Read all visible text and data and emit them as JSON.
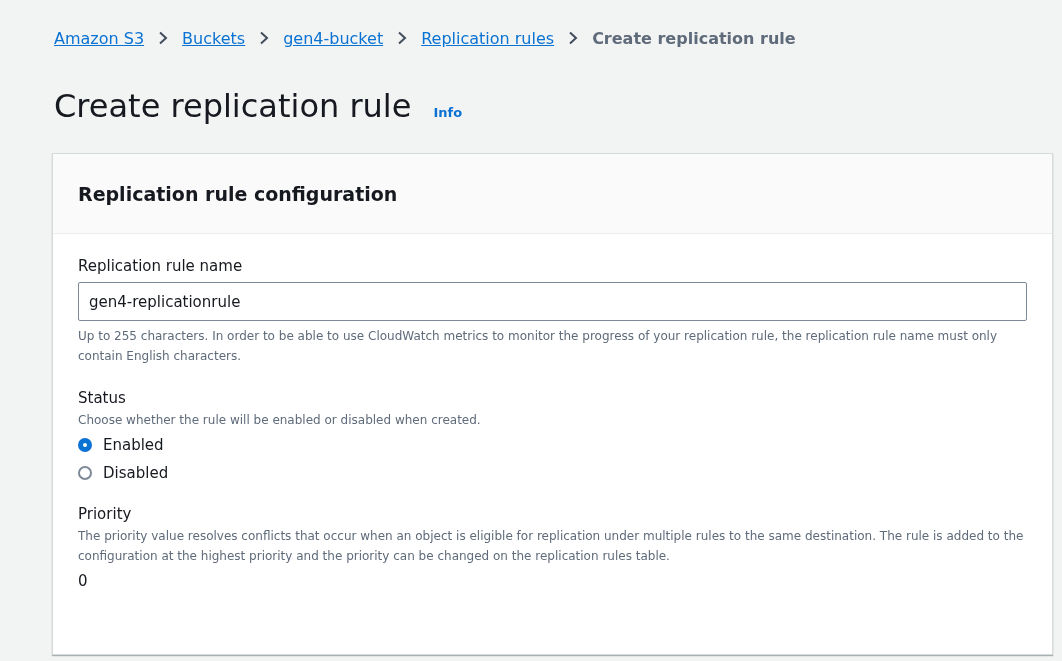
{
  "breadcrumbs": [
    {
      "label": "Amazon S3",
      "link": true
    },
    {
      "label": "Buckets",
      "link": true
    },
    {
      "label": "gen4-bucket",
      "link": true
    },
    {
      "label": "Replication rules",
      "link": true
    },
    {
      "label": "Create replication rule",
      "link": false
    }
  ],
  "page_title": "Create replication rule",
  "info_link": "Info",
  "panel": {
    "title": "Replication rule configuration",
    "name_field": {
      "label": "Replication rule name",
      "value": "gen4-replicationrule",
      "hint": "Up to 255 characters. In order to be able to use CloudWatch metrics to monitor the progress of your replication rule, the replication rule name must only contain English characters."
    },
    "status": {
      "label": "Status",
      "description": "Choose whether the rule will be enabled or disabled when created.",
      "options": [
        {
          "label": "Enabled",
          "selected": true
        },
        {
          "label": "Disabled",
          "selected": false
        }
      ]
    },
    "priority": {
      "label": "Priority",
      "description": "The priority value resolves conflicts that occur when an object is eligible for replication under multiple rules to the same destination. The rule is added to the configuration at the highest priority and the priority can be changed on the replication rules table.",
      "value": "0"
    }
  }
}
